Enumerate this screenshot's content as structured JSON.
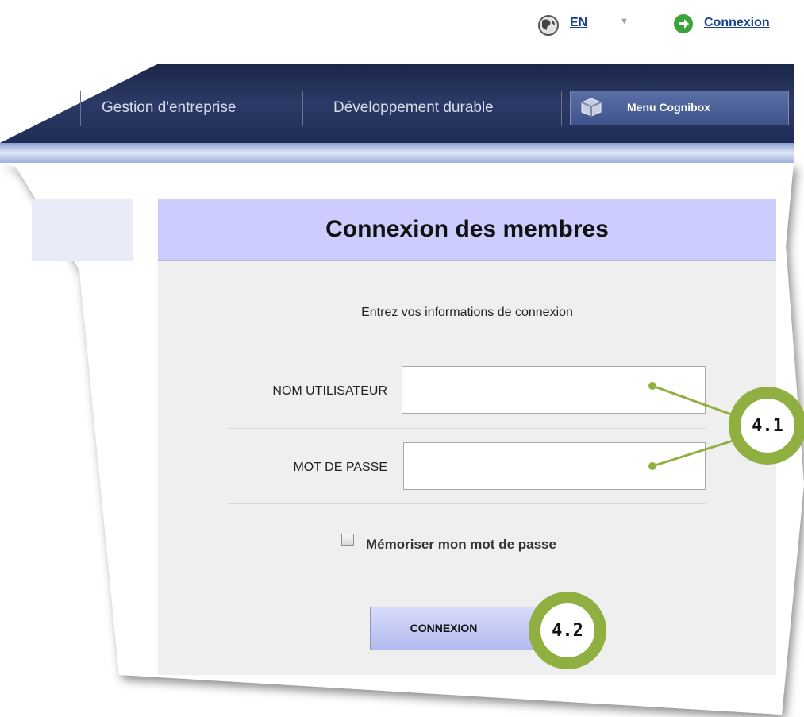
{
  "topbar": {
    "language": "EN",
    "login_link": "Connexion"
  },
  "nav": {
    "items": [
      "Gestion d'entreprise",
      "Développement durable"
    ],
    "menu_button": "Menu Cognibox"
  },
  "login": {
    "title": "Connexion des membres",
    "subtitle": "Entrez vos informations de connexion",
    "username_label": "NOM UTILISATEUR",
    "username_value": "",
    "password_label": "MOT DE PASSE",
    "password_value": "",
    "remember_label": "Mémoriser mon mot de passe",
    "submit_label": "CONNEXION"
  },
  "annotations": {
    "fields_badge": "4.1",
    "button_badge": "4.2"
  },
  "colors": {
    "nav_dark": "#1e2b52",
    "panel_header": "#ccccff",
    "accent_green": "#8fb041",
    "link": "#1a3f8f"
  }
}
